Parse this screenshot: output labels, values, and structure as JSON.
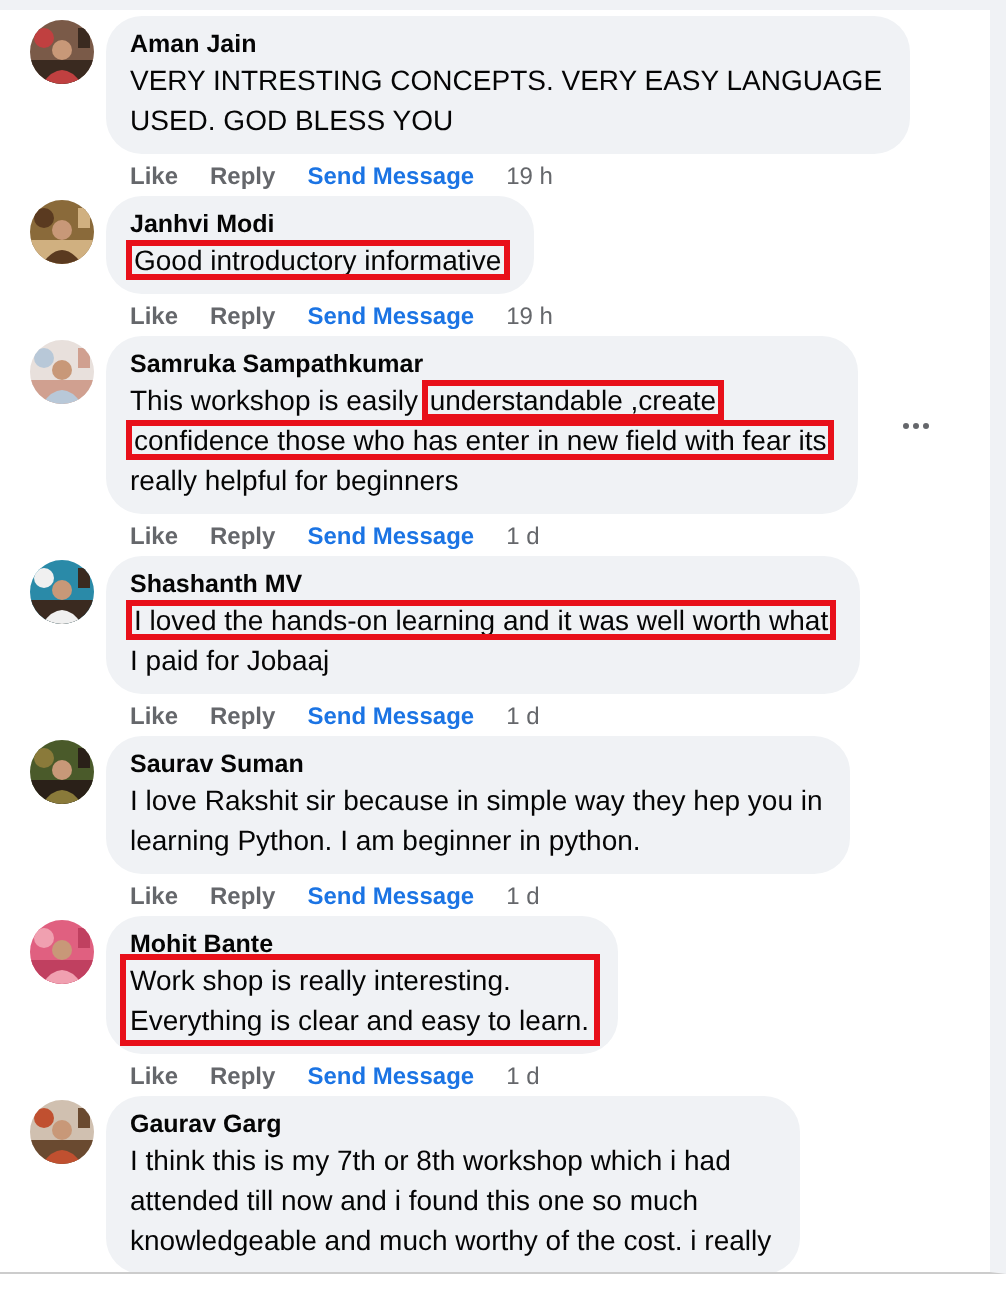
{
  "comments": [
    {
      "author": "Aman Jain",
      "lines": [
        [
          {
            "text": "VERY INTRESTING CONCEPTS. VERY EASY LANGUAGE",
            "marked": false
          }
        ],
        [
          {
            "text": "USED. GOD BLESS YOU",
            "marked": false
          }
        ]
      ],
      "block_marked": false,
      "actions": [
        "Like",
        "Reply",
        "Send Message"
      ],
      "time": "19 h",
      "more": false
    },
    {
      "author": "Janhvi Modi",
      "lines": [
        [
          {
            "text": "Good introductory informative",
            "marked": true
          }
        ]
      ],
      "block_marked": false,
      "actions": [
        "Like",
        "Reply",
        "Send Message"
      ],
      "time": "19 h",
      "more": false
    },
    {
      "author": "Samruka Sampathkumar",
      "lines": [
        [
          {
            "text": "This workshop is easily ",
            "marked": false
          },
          {
            "text": "understandable ,create",
            "marked": true
          }
        ],
        [
          {
            "text": "confidence those who has enter in new field with fear its",
            "marked": true
          }
        ],
        [
          {
            "text": "really helpful for beginners",
            "marked": false
          }
        ]
      ],
      "block_marked": false,
      "actions": [
        "Like",
        "Reply",
        "Send Message"
      ],
      "time": "1 d",
      "more": true
    },
    {
      "author": "Shashanth MV",
      "lines": [
        [
          {
            "text": "I loved the hands-on learning and it was well worth what",
            "marked": true
          }
        ],
        [
          {
            "text": "I paid for Jobaaj",
            "marked": false
          }
        ]
      ],
      "block_marked": false,
      "actions": [
        "Like",
        "Reply",
        "Send Message"
      ],
      "time": "1 d",
      "more": false
    },
    {
      "author": "Saurav Suman",
      "lines": [
        [
          {
            "text": "I love Rakshit sir because in simple way they hep you in",
            "marked": false
          }
        ],
        [
          {
            "text": "learning Python. I am beginner in python.",
            "marked": false
          }
        ]
      ],
      "block_marked": false,
      "actions": [
        "Like",
        "Reply",
        "Send Message"
      ],
      "time": "1 d",
      "more": false
    },
    {
      "author": "Mohit Bante",
      "lines": [
        [
          {
            "text": "Work shop is really interesting.",
            "marked": false
          }
        ],
        [
          {
            "text": "Everything is clear and easy to learn.",
            "marked": false
          }
        ]
      ],
      "block_marked": true,
      "actions": [
        "Like",
        "Reply",
        "Send Message"
      ],
      "time": "1 d",
      "more": false
    },
    {
      "author": "Gaurav Garg",
      "lines": [
        [
          {
            "text": "I think this is my 7th or 8th workshop which i had",
            "marked": false
          }
        ],
        [
          {
            "text": "attended till now and i found this one so much",
            "marked": false
          }
        ],
        [
          {
            "text": "knowledgeable and much worthy of the cost. i really",
            "marked": false
          }
        ]
      ],
      "block_marked": false,
      "more": false
    }
  ]
}
